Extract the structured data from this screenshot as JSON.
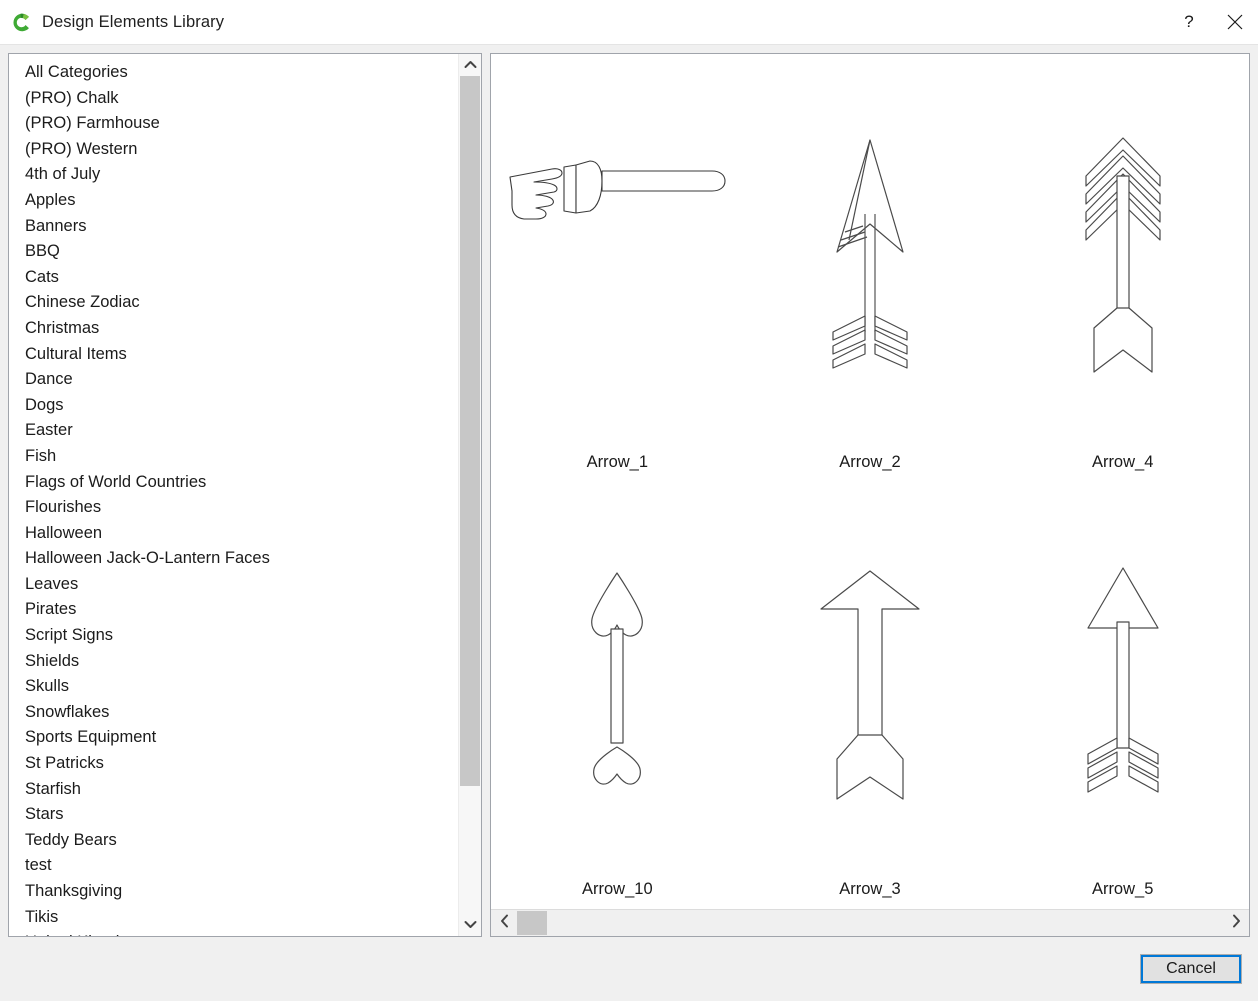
{
  "window": {
    "title": "Design Elements Library",
    "logo_icon": "cricut-c-logo-icon",
    "logo_color": "#3faa35",
    "help_label": "?",
    "help_icon": "help-question-icon",
    "close_icon": "close-x-icon"
  },
  "categories": {
    "items": [
      "All Categories",
      "(PRO) Chalk",
      "(PRO) Farmhouse",
      "(PRO) Western",
      "4th of July",
      "Apples",
      "Banners",
      "BBQ",
      "Cats",
      "Chinese Zodiac",
      "Christmas",
      "Cultural Items",
      "Dance",
      "Dogs",
      "Easter",
      "Fish",
      "Flags of World Countries",
      "Flourishes",
      "Halloween",
      "Halloween Jack-O-Lantern Faces",
      "Leaves",
      "Pirates",
      "Script Signs",
      "Shields",
      "Skulls",
      "Snowflakes",
      "Sports Equipment",
      "St Patricks",
      "Starfish",
      "Stars",
      "Teddy Bears",
      "test",
      "Thanksgiving",
      "Tikis",
      "United Kingdom"
    ],
    "scrollbar": {
      "up_icon": "chevron-up-icon",
      "down_icon": "chevron-down-icon",
      "thumb": "vertical-scroll-thumb"
    }
  },
  "preview": {
    "items": [
      {
        "label": "Arrow_1",
        "art": "hand-pointer-arrow"
      },
      {
        "label": "Arrow_2",
        "art": "feathered-split-arrow"
      },
      {
        "label": "Arrow_4",
        "art": "chevron-fletch-arrow"
      },
      {
        "label": "Arrow_10",
        "art": "heart-tip-arrow"
      },
      {
        "label": "Arrow_3",
        "art": "wide-triangle-arrow"
      },
      {
        "label": "Arrow_5",
        "art": "thin-triangle-feather-arrow"
      }
    ],
    "scrollbar": {
      "left_icon": "chevron-left-icon",
      "right_icon": "chevron-right-icon",
      "thumb": "horizontal-scroll-thumb"
    }
  },
  "footer": {
    "cancel_label": "Cancel",
    "focus_color": "#0078d7"
  }
}
